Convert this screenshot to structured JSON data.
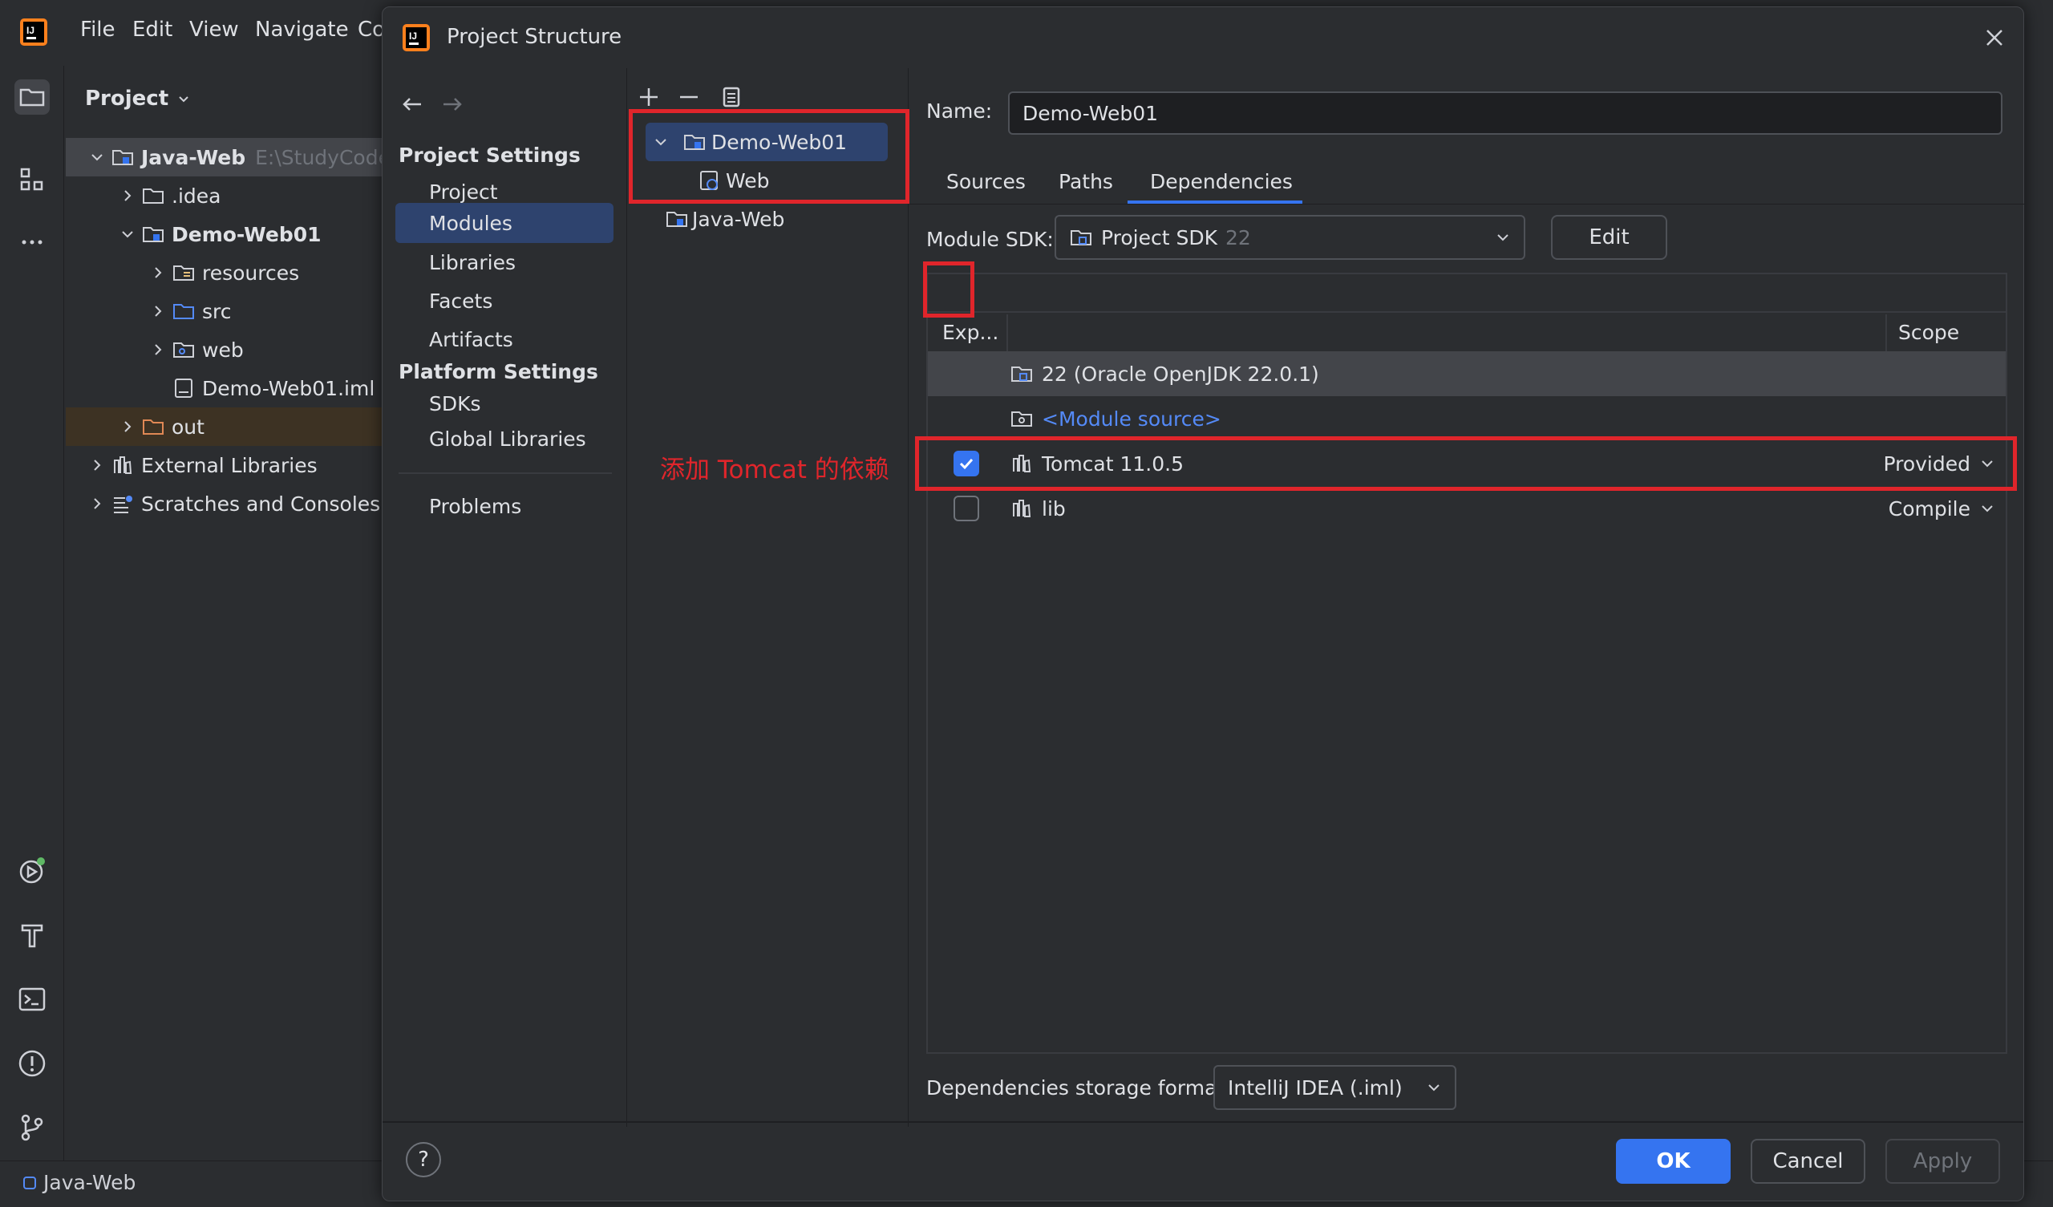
{
  "ide": {
    "menu": [
      "File",
      "Edit",
      "View",
      "Navigate",
      "Co"
    ],
    "project_panel_title": "Project",
    "tree": [
      {
        "label": "Java-Web",
        "suffix": "E:\\StudyCode\\",
        "bold": true,
        "expanded": true
      },
      {
        "label": ".idea"
      },
      {
        "label": "Demo-Web01",
        "bold": true
      },
      {
        "label": "resources"
      },
      {
        "label": "src"
      },
      {
        "label": "web"
      },
      {
        "label": "Demo-Web01.iml"
      },
      {
        "label": "out"
      },
      {
        "label": "External Libraries"
      },
      {
        "label": "Scratches and Consoles"
      }
    ],
    "status_project": "Java-Web"
  },
  "dialog": {
    "title": "Project Structure",
    "project_settings_header": "Project Settings",
    "project_settings": [
      "Project",
      "Modules",
      "Libraries",
      "Facets",
      "Artifacts"
    ],
    "platform_settings_header": "Platform Settings",
    "platform_settings": [
      "SDKs",
      "Global Libraries"
    ],
    "problems": "Problems",
    "modules": [
      "Demo-Web01",
      "Web",
      "Java-Web"
    ],
    "name_label": "Name:",
    "name_value": "Demo-Web01",
    "tabs": [
      "Sources",
      "Paths",
      "Dependencies"
    ],
    "active_tab": "Dependencies",
    "module_sdk_label": "Module SDK:",
    "module_sdk_value": "Project SDK",
    "module_sdk_version": "22",
    "edit_button": "Edit",
    "table_headers": {
      "export": "Exp...",
      "scope": "Scope"
    },
    "dependencies": [
      {
        "name": "22 (Oracle OpenJDK 22.0.1)",
        "checkbox": false,
        "scope": ""
      },
      {
        "name": "<Module source>",
        "checkbox": false,
        "scope": "",
        "link": true
      },
      {
        "name": "Tomcat 11.0.5",
        "checkbox": true,
        "checked": true,
        "scope": "Provided"
      },
      {
        "name": "lib",
        "checkbox": true,
        "checked": false,
        "scope": "Compile"
      }
    ],
    "storage_format_label": "Dependencies storage format:",
    "storage_format_value": "IntelliJ IDEA (.iml)",
    "buttons": {
      "ok": "OK",
      "cancel": "Cancel",
      "apply": "Apply"
    },
    "help": "?"
  },
  "annotation": "添加 Tomcat 的依赖",
  "colors": {
    "accent": "#3574f0",
    "selection": "#2e436e",
    "highlight_red": "#e0252b",
    "background": "#2b2d30"
  }
}
